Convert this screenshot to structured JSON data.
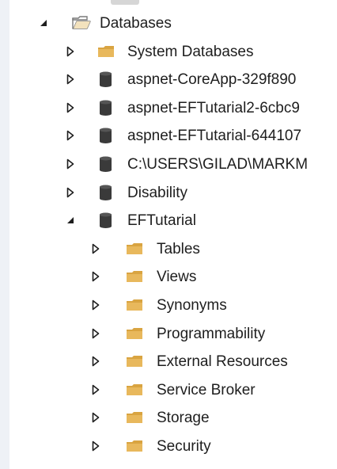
{
  "window": {
    "background": "#eef1f6",
    "panel_background": "#ffffff",
    "text_color": "#1e1e1e"
  },
  "tree": {
    "databases_node": {
      "label": "Databases",
      "state": "expanded",
      "icon": "open-folder-icon"
    },
    "items": [
      {
        "name": "tree-item-system-databases",
        "label": "System Databases",
        "icon": "folder-icon",
        "state": "collapsed"
      },
      {
        "name": "tree-item-aspnet-coreapp",
        "label": "aspnet-CoreApp-329f890",
        "icon": "database-icon",
        "state": "collapsed"
      },
      {
        "name": "tree-item-aspnet-eftutarial2",
        "label": "aspnet-EFTutarial2-6cbc9",
        "icon": "database-icon",
        "state": "collapsed"
      },
      {
        "name": "tree-item-aspnet-eftutarial",
        "label": "aspnet-EFTutarial-644107",
        "icon": "database-icon",
        "state": "collapsed"
      },
      {
        "name": "tree-item-users-gilad-markm",
        "label": "C:\\USERS\\GILAD\\MARKM",
        "icon": "database-icon",
        "state": "collapsed"
      },
      {
        "name": "tree-item-disability",
        "label": "Disability",
        "icon": "database-icon",
        "state": "collapsed"
      },
      {
        "name": "tree-item-eftutarial",
        "label": "EFTutarial",
        "icon": "database-icon",
        "state": "expanded"
      }
    ],
    "eftutarial_children": [
      {
        "name": "tree-item-tables",
        "label": "Tables",
        "icon": "folder-icon",
        "state": "collapsed"
      },
      {
        "name": "tree-item-views",
        "label": "Views",
        "icon": "folder-icon",
        "state": "collapsed"
      },
      {
        "name": "tree-item-synonyms",
        "label": "Synonyms",
        "icon": "folder-icon",
        "state": "collapsed"
      },
      {
        "name": "tree-item-programmability",
        "label": "Programmability",
        "icon": "folder-icon",
        "state": "collapsed"
      },
      {
        "name": "tree-item-external-resources",
        "label": "External Resources",
        "icon": "folder-icon",
        "state": "collapsed"
      },
      {
        "name": "tree-item-service-broker",
        "label": "Service Broker",
        "icon": "folder-icon",
        "state": "collapsed"
      },
      {
        "name": "tree-item-storage",
        "label": "Storage",
        "icon": "folder-icon",
        "state": "collapsed"
      },
      {
        "name": "tree-item-security",
        "label": "Security",
        "icon": "folder-icon",
        "state": "collapsed"
      }
    ]
  }
}
